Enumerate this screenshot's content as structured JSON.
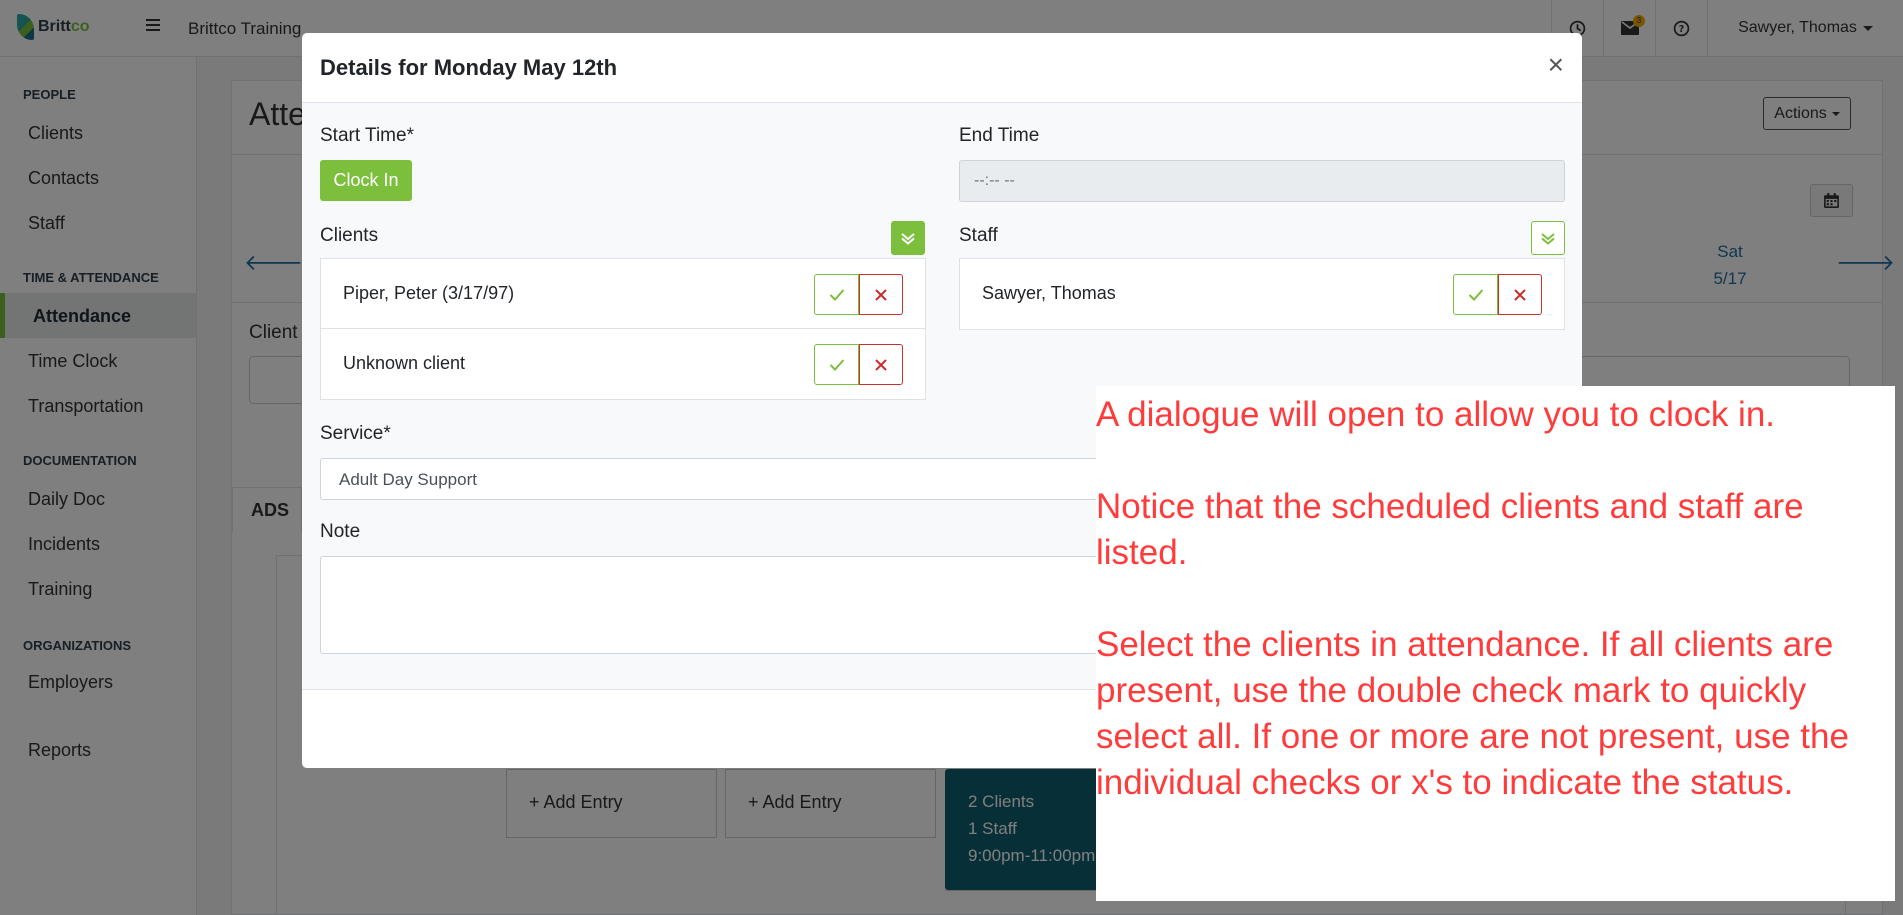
{
  "app": {
    "logo_text": "Britt",
    "logo_text_accent": "co",
    "org_name": "Brittco Training",
    "mail_count": "3"
  },
  "header": {
    "user_name": "Sawyer, Thomas"
  },
  "sidebar": {
    "sections": [
      {
        "heading": "PEOPLE",
        "items": [
          "Clients",
          "Contacts",
          "Staff"
        ]
      },
      {
        "heading": "TIME & ATTENDANCE",
        "items": [
          "Attendance",
          "Time Clock",
          "Transportation"
        ]
      },
      {
        "heading": "DOCUMENTATION",
        "items": [
          "Daily Doc",
          "Incidents",
          "Training"
        ]
      },
      {
        "heading": "ORGANIZATIONS",
        "items": [
          "Employers"
        ]
      }
    ],
    "reports": "Reports",
    "active_item": "Attendance"
  },
  "background": {
    "page_title": "Atte",
    "actions_label": "Actions",
    "sat_day": "Sat",
    "sat_date": "5/17",
    "client_label": "Client",
    "tab_label": "ADS",
    "add_entry_label": "+ Add Entry",
    "card_clients": "2 Clients",
    "card_staff": "1 Staff",
    "card_time": "9:00pm-11:00pm"
  },
  "modal": {
    "title": "Details for Monday May 12th",
    "close_symbol": "×",
    "start_time_label": "Start Time*",
    "clock_in_label": "Clock In",
    "end_time_label": "End Time",
    "end_time_placeholder": "--:-- --",
    "clients_label": "Clients",
    "clients": [
      "Piper, Peter (3/17/97)",
      "Unknown client"
    ],
    "staff_label": "Staff",
    "staff": [
      "Sawyer, Thomas"
    ],
    "service_label": "Service*",
    "service_value": "Adult Day Support",
    "note_label": "Note"
  },
  "annotation": {
    "paragraphs": [
      "A dialogue will open to allow you to clock in.",
      "Notice that the scheduled clients and staff are listed.",
      "Select the clients in attendance. If all clients are present, use the double check mark to quickly select all. If one or more are not present, use the individual checks or x's to indicate the status."
    ]
  },
  "colors": {
    "brand_green": "#7bbf3c",
    "danger_red": "#c9302c",
    "annotation_red": "#ff3b3b",
    "teal": "#0f5e6e"
  }
}
